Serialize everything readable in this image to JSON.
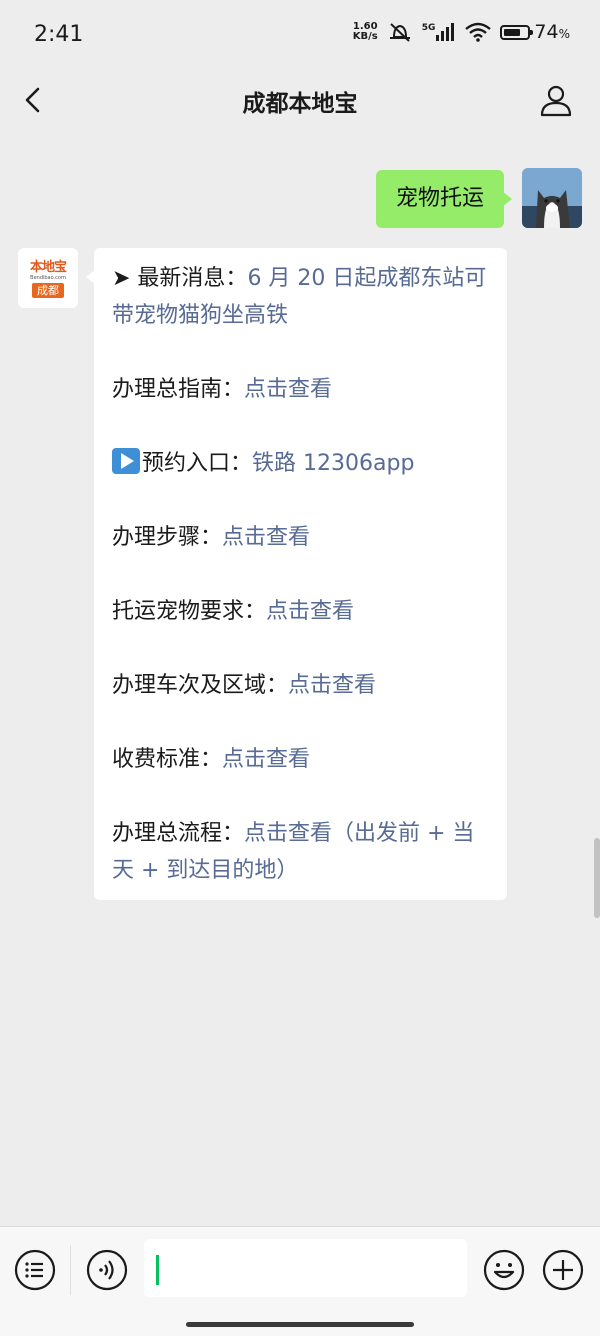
{
  "status_bar": {
    "time": "2:41",
    "net_speed_value": "1.60",
    "net_speed_unit": "KB/s",
    "network": "5G",
    "battery_percent": "74",
    "battery_unit": "%",
    "battery_level": 0.74
  },
  "header": {
    "title": "成都本地宝",
    "back_icon": "chevron-left-icon",
    "profile_icon": "person-icon"
  },
  "chat": {
    "outgoing": {
      "text": "宠物托运"
    },
    "bot_avatar": {
      "logo_top": "本地宝",
      "logo_url": "Bendibao.com",
      "logo_city": "成都"
    },
    "incoming": {
      "news_prefix": "➤ 最新消息：",
      "news_link": "6 月 20 日起成都东站可带宠物猫狗坐高铁",
      "guide_label": "办理总指南：",
      "guide_link": "点击查看",
      "booking_label": "预约入口：",
      "booking_link": "铁路 12306app",
      "steps_label": "办理步骤：",
      "steps_link": "点击查看",
      "requirements_label": "托运宠物要求：",
      "requirements_link": "点击查看",
      "trains_label": "办理车次及区域：",
      "trains_link": "点击查看",
      "fee_label": "收费标准：",
      "fee_link": "点击查看",
      "process_label": "办理总流程：",
      "process_link": "点击查看（出发前 + 当天 + 到达目的地）"
    }
  },
  "input_bar": {
    "menu_icon": "menu-list-icon",
    "voice_icon": "voice-icon",
    "emoji_icon": "emoji-icon",
    "plus_icon": "plus-icon",
    "input_value": ""
  },
  "colors": {
    "background": "#ededed",
    "outgoing_bubble": "#95ec69",
    "link": "#576b95",
    "caret": "#07c160"
  }
}
